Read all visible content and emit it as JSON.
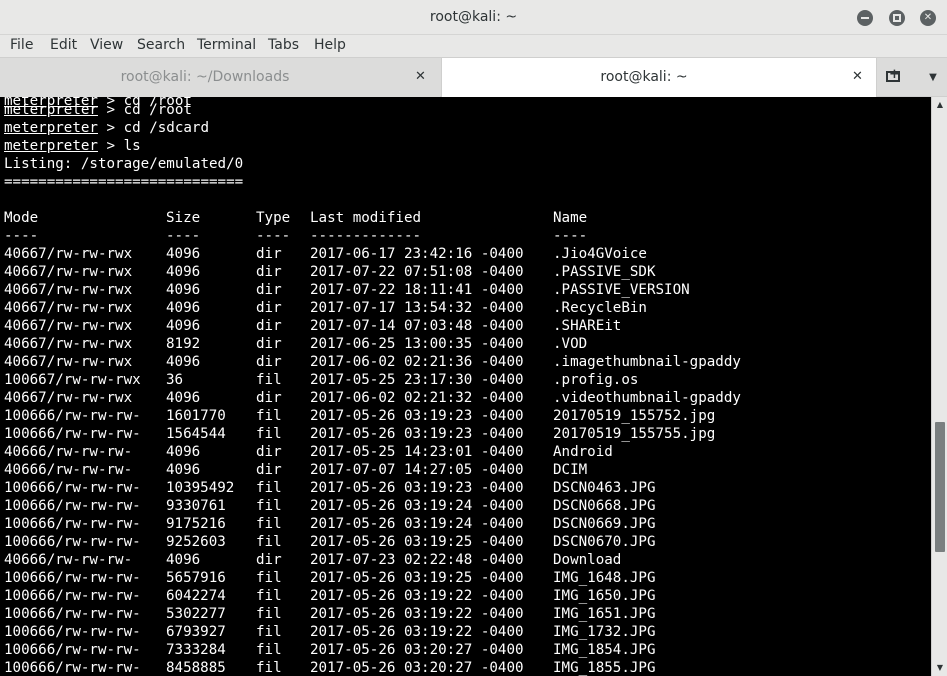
{
  "window": {
    "title": "root@kali: ~"
  },
  "menu": [
    "File",
    "Edit",
    "View",
    "Search",
    "Terminal",
    "Tabs",
    "Help"
  ],
  "tabs": [
    {
      "label": "root@kali: ~/Downloads",
      "active": false
    },
    {
      "label": "root@kali: ~",
      "active": true
    }
  ],
  "icons": {
    "minimize": "minimize-icon",
    "maximize": "maximize-icon",
    "close": "close-icon",
    "tab_close": "close-icon",
    "new_tab": "new-tab-icon",
    "tab_menu": "dropdown-arrow-icon"
  },
  "colors": {
    "terminal_bg": "#000000",
    "terminal_fg": "#ffffff",
    "chrome_bg": "#e8e8e7"
  },
  "terminal": {
    "prompt": "meterpreter",
    "commands": [
      " > cd /root",
      " > cd /sdcard",
      " > ls"
    ],
    "listing_header": "Listing: /storage/emulated/0",
    "separator": "============================",
    "columns": [
      "Mode",
      "Size",
      "Type",
      "Last modified",
      "Name"
    ],
    "column_underlines": [
      "----",
      "----",
      "----",
      "-------------",
      "----"
    ],
    "rows": [
      [
        "40667/rw-rw-rwx",
        "4096",
        "dir",
        "2017-06-17 23:42:16 -0400",
        ".Jio4GVoice"
      ],
      [
        "40667/rw-rw-rwx",
        "4096",
        "dir",
        "2017-07-22 07:51:08 -0400",
        ".PASSIVE_SDK"
      ],
      [
        "40667/rw-rw-rwx",
        "4096",
        "dir",
        "2017-07-22 18:11:41 -0400",
        ".PASSIVE_VERSION"
      ],
      [
        "40667/rw-rw-rwx",
        "4096",
        "dir",
        "2017-07-17 13:54:32 -0400",
        ".RecycleBin"
      ],
      [
        "40667/rw-rw-rwx",
        "4096",
        "dir",
        "2017-07-14 07:03:48 -0400",
        ".SHAREit"
      ],
      [
        "40667/rw-rw-rwx",
        "8192",
        "dir",
        "2017-06-25 13:00:35 -0400",
        ".VOD"
      ],
      [
        "40667/rw-rw-rwx",
        "4096",
        "dir",
        "2017-06-02 02:21:36 -0400",
        ".imagethumbnail-gpaddy"
      ],
      [
        "100667/rw-rw-rwx",
        "36",
        "fil",
        "2017-05-25 23:17:30 -0400",
        ".profig.os"
      ],
      [
        "40667/rw-rw-rwx",
        "4096",
        "dir",
        "2017-06-02 02:21:32 -0400",
        ".videothumbnail-gpaddy"
      ],
      [
        "100666/rw-rw-rw-",
        "1601770",
        "fil",
        "2017-05-26 03:19:23 -0400",
        "20170519_155752.jpg"
      ],
      [
        "100666/rw-rw-rw-",
        "1564544",
        "fil",
        "2017-05-26 03:19:23 -0400",
        "20170519_155755.jpg"
      ],
      [
        "40666/rw-rw-rw-",
        "4096",
        "dir",
        "2017-05-25 14:23:01 -0400",
        "Android"
      ],
      [
        "40666/rw-rw-rw-",
        "4096",
        "dir",
        "2017-07-07 14:27:05 -0400",
        "DCIM"
      ],
      [
        "100666/rw-rw-rw-",
        "10395492",
        "fil",
        "2017-05-26 03:19:23 -0400",
        "DSCN0463.JPG"
      ],
      [
        "100666/rw-rw-rw-",
        "9330761",
        "fil",
        "2017-05-26 03:19:24 -0400",
        "DSCN0668.JPG"
      ],
      [
        "100666/rw-rw-rw-",
        "9175216",
        "fil",
        "2017-05-26 03:19:24 -0400",
        "DSCN0669.JPG"
      ],
      [
        "100666/rw-rw-rw-",
        "9252603",
        "fil",
        "2017-05-26 03:19:25 -0400",
        "DSCN0670.JPG"
      ],
      [
        "40666/rw-rw-rw-",
        "4096",
        "dir",
        "2017-07-23 02:22:48 -0400",
        "Download"
      ],
      [
        "100666/rw-rw-rw-",
        "5657916",
        "fil",
        "2017-05-26 03:19:25 -0400",
        "IMG_1648.JPG"
      ],
      [
        "100666/rw-rw-rw-",
        "6042274",
        "fil",
        "2017-05-26 03:19:22 -0400",
        "IMG_1650.JPG"
      ],
      [
        "100666/rw-rw-rw-",
        "5302277",
        "fil",
        "2017-05-26 03:19:22 -0400",
        "IMG_1651.JPG"
      ],
      [
        "100666/rw-rw-rw-",
        "6793927",
        "fil",
        "2017-05-26 03:19:22 -0400",
        "IMG_1732.JPG"
      ],
      [
        "100666/rw-rw-rw-",
        "7333284",
        "fil",
        "2017-05-26 03:20:27 -0400",
        "IMG_1854.JPG"
      ],
      [
        "100666/rw-rw-rw-",
        "8458885",
        "fil",
        "2017-05-26 03:20:27 -0400",
        "IMG_1855.JPG"
      ]
    ]
  }
}
